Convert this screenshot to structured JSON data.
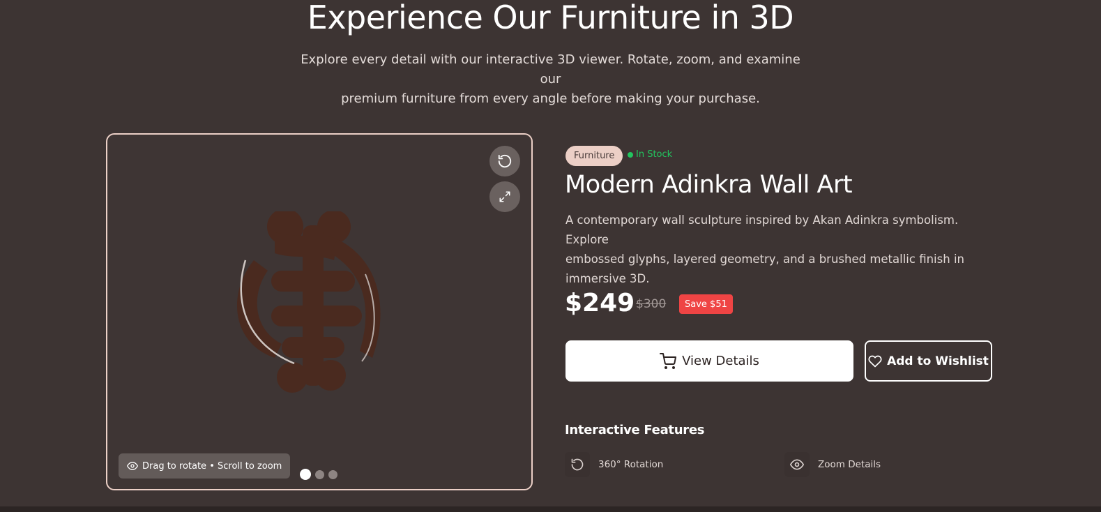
{
  "hero": {
    "title": "Experience Our Furniture in 3D",
    "subtitle_line1": "Explore every detail with our interactive 3D viewer. Rotate, zoom, and examine our",
    "subtitle_line2": "premium furniture from every angle before making your purchase."
  },
  "viewer": {
    "controls": [
      {
        "icon": "rotate-reset-icon"
      },
      {
        "icon": "fullscreen-icon"
      }
    ],
    "hint_icon": "eye-icon",
    "hint_text": "Drag to rotate • Scroll to zoom",
    "slides": {
      "count": 3,
      "active": 1
    },
    "border_color": "#ecd0c7",
    "model_color": "#4a2a1f"
  },
  "product": {
    "category": "Furniture",
    "stock_status": "In Stock",
    "title": "Modern Adinkra Wall Art",
    "description_line1": "A contemporary wall sculpture inspired by Akan Adinkra symbolism. Explore",
    "description_line2": "embossed glyphs, layered geometry, and a brushed metallic finish in",
    "description_line3": "immersive 3D.",
    "price": "$249",
    "original_price": "$300",
    "savings": "Save $51"
  },
  "actions": {
    "view_details": {
      "label": "View Details",
      "icon": "cart-icon"
    },
    "wishlist": {
      "label": "Add to Wishlist",
      "icon": "heart-icon"
    }
  },
  "features": {
    "title": "Interactive Features",
    "items": [
      {
        "label": "360° Rotation",
        "icon": "rotate-icon"
      },
      {
        "label": "Zoom Details",
        "icon": "eye-icon"
      }
    ]
  },
  "colors": {
    "background": "#3d3433",
    "accent_badge": "#eccfc6",
    "stock_green": "#22c55e",
    "save_red": "#ef4444"
  }
}
